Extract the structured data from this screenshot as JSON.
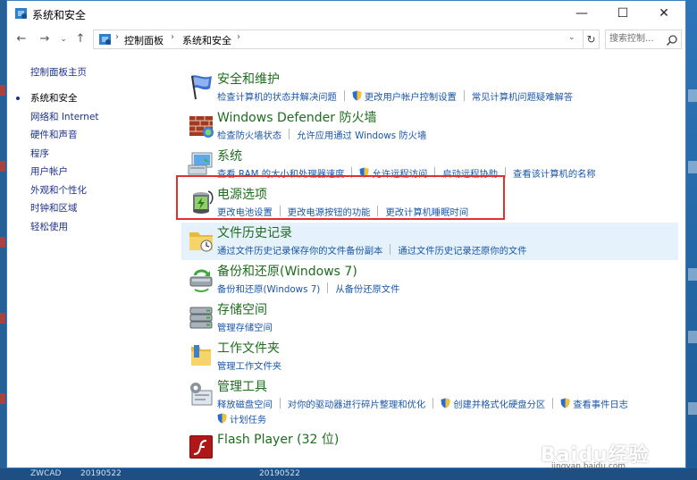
{
  "window": {
    "title": "系统和安全",
    "minimize": "—",
    "maximize": "☐",
    "close": "✕"
  },
  "nav": {
    "back": "←",
    "forward": "→",
    "dropdown": "⌄",
    "up": "↑",
    "breadcrumb": [
      "控制面板",
      "系统和安全"
    ],
    "separator": "›",
    "address_dropdown": "⌄",
    "refresh": "↻",
    "search_placeholder": "搜索控制..."
  },
  "sidebar": {
    "items": [
      {
        "label": "控制面板主页",
        "current": false
      },
      {
        "label": "系统和安全",
        "current": true
      },
      {
        "label": "网络和 Internet",
        "current": false
      },
      {
        "label": "硬件和声音",
        "current": false
      },
      {
        "label": "程序",
        "current": false
      },
      {
        "label": "用户帐户",
        "current": false
      },
      {
        "label": "外观和个性化",
        "current": false
      },
      {
        "label": "时钟和区域",
        "current": false
      },
      {
        "label": "轻松使用",
        "current": false
      }
    ]
  },
  "categories": [
    {
      "title": "安全和维护",
      "icon": "flag-icon",
      "links": [
        {
          "text": "检查计算机的状态并解决问题"
        },
        {
          "text": "更改用户帐户控制设置",
          "shield": true
        },
        {
          "text": "常见计算机问题疑难解答"
        }
      ]
    },
    {
      "title": "Windows Defender 防火墙",
      "icon": "firewall-icon",
      "links": [
        {
          "text": "检查防火墙状态"
        },
        {
          "text": "允许应用通过 Windows 防火墙"
        }
      ]
    },
    {
      "title": "系统",
      "icon": "computer-icon",
      "links": [
        {
          "text": "查看 RAM 的大小和处理器速度"
        },
        {
          "text": "允许远程访问",
          "shield": true
        },
        {
          "text": "启动远程协助"
        },
        {
          "text": "查看该计算机的名称"
        }
      ]
    },
    {
      "title": "电源选项",
      "icon": "battery-icon",
      "links": [
        {
          "text": "更改电池设置"
        },
        {
          "text": "更改电源按钮的功能"
        },
        {
          "text": "更改计算机睡眠时间"
        }
      ]
    },
    {
      "title": "文件历史记录",
      "icon": "file-history-icon",
      "links": [
        {
          "text": "通过文件历史记录保存你的文件备份副本"
        },
        {
          "text": "通过文件历史记录还原你的文件"
        }
      ]
    },
    {
      "title": "备份和还原(Windows 7)",
      "icon": "backup-icon",
      "links": [
        {
          "text": "备份和还原(Windows 7)"
        },
        {
          "text": "从备份还原文件"
        }
      ]
    },
    {
      "title": "存储空间",
      "icon": "storage-icon",
      "links": [
        {
          "text": "管理存储空间"
        }
      ]
    },
    {
      "title": "工作文件夹",
      "icon": "work-folder-icon",
      "links": [
        {
          "text": "管理工作文件夹"
        }
      ]
    },
    {
      "title": "管理工具",
      "icon": "admin-tools-icon",
      "links": [
        {
          "text": "释放磁盘空间"
        },
        {
          "text": "对你的驱动器进行碎片整理和优化"
        },
        {
          "text": "创建并格式化硬盘分区",
          "shield": true
        },
        {
          "text": "查看事件日志",
          "shield": true
        }
      ],
      "links_line2": [
        {
          "text": "计划任务",
          "shield": true
        }
      ]
    },
    {
      "title": "Flash Player (32 位)",
      "icon": "flash-icon",
      "links": []
    }
  ],
  "highlight": {
    "category": "电源选项",
    "color": "#e03030"
  },
  "watermark": {
    "main": "Baidu经验",
    "sub": "jingyan.baidu.com"
  },
  "desktop_bottom": [
    "ZWCAD",
    "20190522",
    "20190522"
  ],
  "colors": {
    "link": "#1b56a8",
    "category_title": "#1f6b1f",
    "sidebar_link": "#1e3287",
    "row_highlight": "#e5f1fb"
  }
}
